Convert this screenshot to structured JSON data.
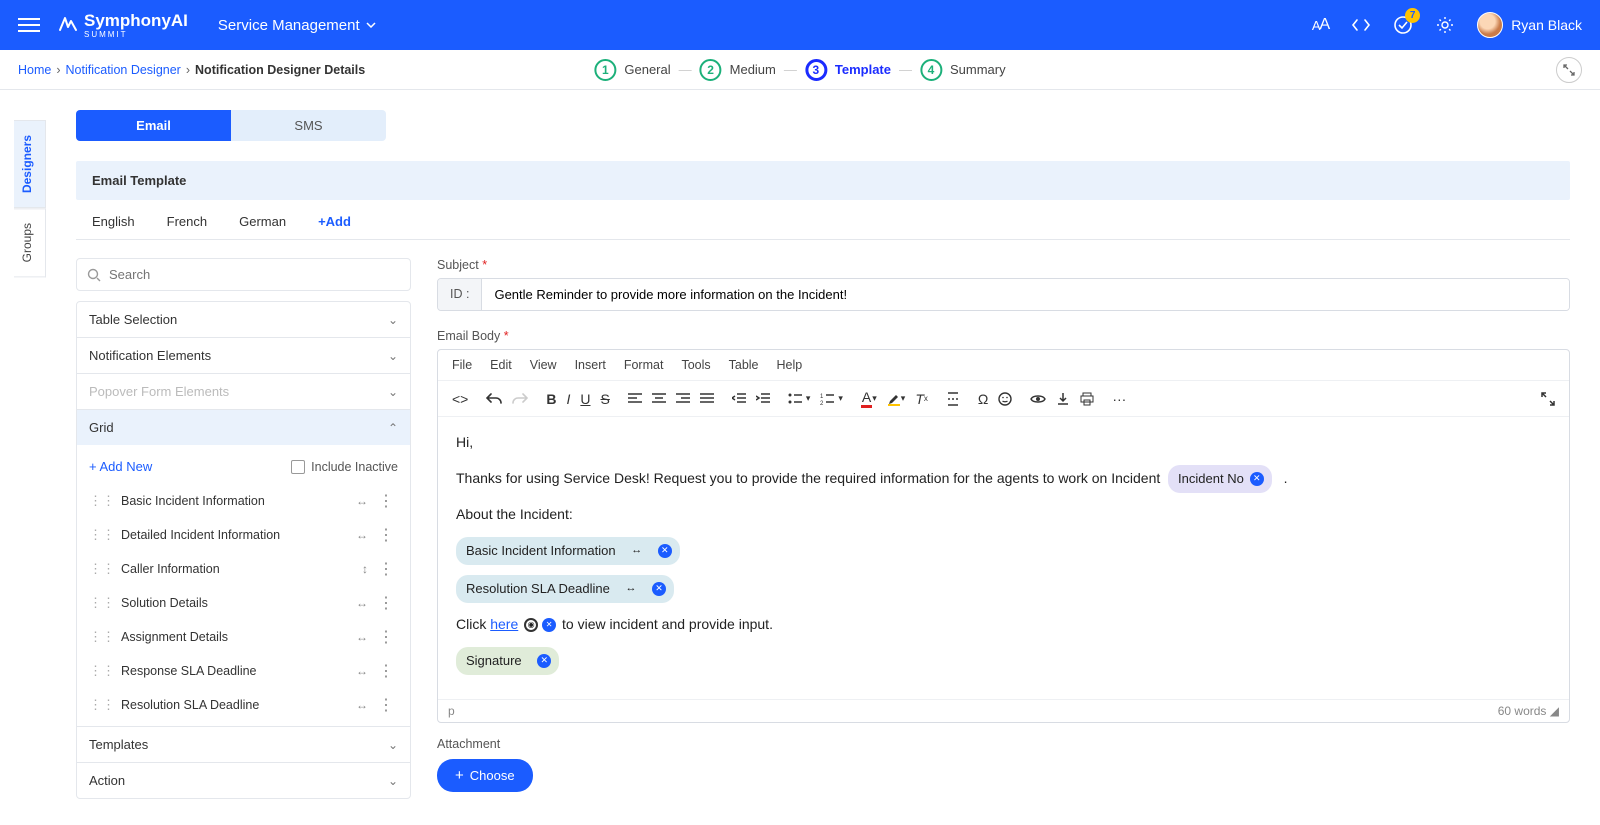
{
  "appbar": {
    "brand_main": "SymphonyAI",
    "brand_sub": "SUMMIT",
    "module": "Service Management",
    "notification_count": "7",
    "user_name": "Ryan Black"
  },
  "breadcrumb": {
    "home": "Home",
    "designer": "Notification Designer",
    "current": "Notification Designer Details"
  },
  "stepper": {
    "s1": "General",
    "s2": "Medium",
    "s3": "Template",
    "s4": "Summary"
  },
  "vtabs": {
    "designers": "Designers",
    "groups": "Groups"
  },
  "channels": {
    "email": "Email",
    "sms": "SMS"
  },
  "section": {
    "email_template": "Email Template"
  },
  "langs": {
    "en": "English",
    "fr": "French",
    "de": "German",
    "add": "+Add"
  },
  "search": {
    "placeholder": "Search"
  },
  "accordion": {
    "table_selection": "Table Selection",
    "notification_elements": "Notification Elements",
    "popover_form_elements": "Popover Form Elements",
    "grid": "Grid",
    "templates": "Templates",
    "action": "Action"
  },
  "grid": {
    "add_new": "+ Add New",
    "include_inactive": "Include Inactive",
    "items": [
      {
        "name": "Basic Incident Information",
        "dir": "↔"
      },
      {
        "name": "Detailed Incident Information",
        "dir": "↔"
      },
      {
        "name": "Caller Information",
        "dir": "↕"
      },
      {
        "name": "Solution Details",
        "dir": "↔"
      },
      {
        "name": "Assignment Details",
        "dir": "↔"
      },
      {
        "name": "Response SLA Deadline",
        "dir": "↔"
      },
      {
        "name": "Resolution SLA Deadline",
        "dir": "↔"
      }
    ]
  },
  "editor": {
    "subject_label": "Subject",
    "id_label": "ID :",
    "subject_value": "Gentle Reminder to provide more information on the Incident!",
    "body_label": "Email Body",
    "menu": {
      "file": "File",
      "edit": "Edit",
      "view": "View",
      "insert": "Insert",
      "format": "Format",
      "tools": "Tools",
      "table": "Table",
      "help": "Help"
    },
    "body": {
      "hi": "Hi,",
      "line1_a": "Thanks for using Service Desk! Request you to provide the required information for the agents to work on Incident",
      "pill_incident_no": "Incident No",
      "dot": ".",
      "about": "About the Incident:",
      "pill_basic": "Basic Incident Information",
      "pill_res": "Resolution SLA Deadline",
      "click": "Click",
      "here": "here",
      "after_here": "to view incident and provide input.",
      "pill_sig": "Signature"
    },
    "status_path": "p",
    "status_words": "60 words",
    "attachment_label": "Attachment",
    "choose": "Choose"
  }
}
